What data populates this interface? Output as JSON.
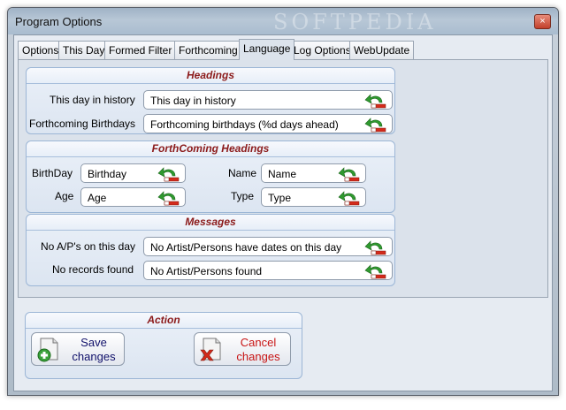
{
  "window": {
    "title": "Program Options",
    "watermark": "SOFTPEDIA",
    "close": "×"
  },
  "tabs": [
    "Options",
    "This Day",
    "Formed Filter",
    "Forthcoming",
    "Language",
    "Log Options",
    "WebUpdate"
  ],
  "active_tab": "Language",
  "headings": {
    "title": "Headings",
    "this_day_label": "This day in history",
    "this_day_value": "This day in history",
    "forthcoming_label": "Forthcoming Birthdays",
    "forthcoming_value": "Forthcoming birthdays (%d days ahead)"
  },
  "forthcoming_headings": {
    "title": "ForthComing Headings",
    "birthday_label": "BirthDay",
    "birthday_value": "Birthday",
    "age_label": "Age",
    "age_value": "Age",
    "name_label": "Name",
    "name_value": "Name",
    "type_label": "Type",
    "type_value": "Type"
  },
  "messages": {
    "title": "Messages",
    "no_ap_label": "No A/P's on this day",
    "no_ap_value": "No Artist/Persons have dates on this day",
    "no_records_label": "No records found",
    "no_records_value": "No Artist/Persons found"
  },
  "action": {
    "title": "Action",
    "save_line1": "Save",
    "save_line2": "changes",
    "cancel_line1": "Cancel",
    "cancel_line2": "changes"
  },
  "colors": {
    "heading_text": "#8b1a1a",
    "save_text": "#10106a",
    "cancel_text": "#c81414",
    "reset_arrow": "#2f9a2f",
    "reset_bar": "#d42a1a"
  },
  "icons": {
    "reset": "undo-arrow-icon",
    "save": "save-plus-icon",
    "cancel": "cancel-x-icon"
  }
}
